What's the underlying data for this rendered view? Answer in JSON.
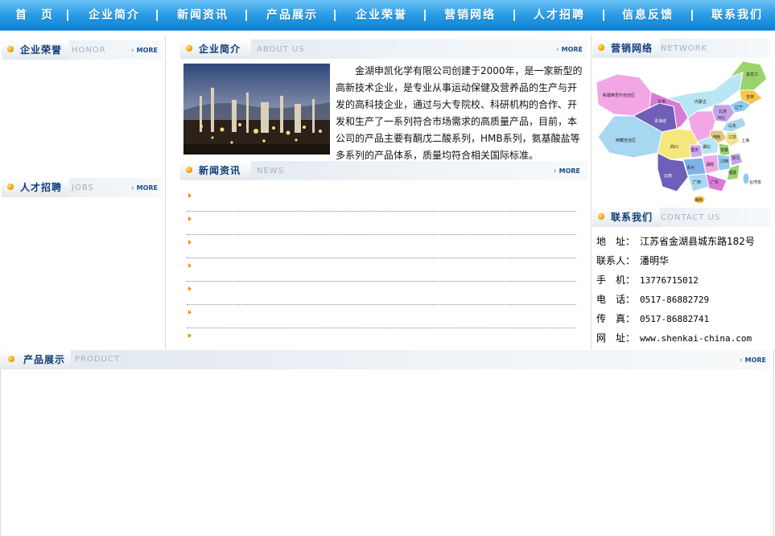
{
  "nav": {
    "items": [
      "首　页",
      "企业简介",
      "新闻资讯",
      "产品展示",
      "企业荣誉",
      "营销网络",
      "人才招聘",
      "信息反馈",
      "联系我们"
    ]
  },
  "honor": {
    "title_cn": "企业荣誉",
    "title_en": "HONOR",
    "more": "MORE"
  },
  "jobs": {
    "title_cn": "人才招聘",
    "title_en": "JOBS",
    "more": "MORE"
  },
  "about": {
    "title_cn": "企业简介",
    "title_en": "ABOUT US",
    "more": "MORE",
    "text": "金湖申凯化学有限公司创建于2000年，是一家新型的高新技术企业，是专业从事运动保健及营养品的生产与开发的高科技企业，通过与大专院校、科研机构的合作、开发和生产了一系列符合市场需求的高质量产品，目前，本公司的产品主要有酮戊二酸系列，HMB系列，氨基酸盐等多系列的产品体系，质量均符合相关国际标准。"
  },
  "news": {
    "title_cn": "新闻资讯",
    "title_en": "NEWS",
    "more": "MORE",
    "row_count": 7
  },
  "network": {
    "title_cn": "营销网络",
    "title_en": "NETWORK",
    "map_labels": [
      "新疆维吾尔自治区",
      "西藏自治区",
      "青海省",
      "甘肃",
      "四川",
      "内蒙古",
      "黑龙江",
      "吉林",
      "辽宁",
      "河北",
      "北京",
      "山东",
      "河南",
      "江苏",
      "上海",
      "安徽",
      "湖北",
      "重庆",
      "贵州",
      "湖南",
      "江西",
      "浙江",
      "福建",
      "云南",
      "广西",
      "广东",
      "海南",
      "台湾省"
    ]
  },
  "contact": {
    "title_cn": "联系我们",
    "title_en": "CONTACT US",
    "rows": [
      {
        "label": "地　址：",
        "value": "江苏省金湖县城东路182号"
      },
      {
        "label": "联系人：",
        "value": "潘明华"
      },
      {
        "label": "手　机：",
        "value": "13776715012"
      },
      {
        "label": "电　话：",
        "value": "0517-86882729"
      },
      {
        "label": "传　真：",
        "value": "0517-86882741"
      },
      {
        "label": "网　址：",
        "value": "www.shenkai-china.com"
      }
    ]
  },
  "product": {
    "title_cn": "产品展示",
    "title_en": "PRODUCT",
    "more": "MORE"
  },
  "colors": {
    "nav_top": "#6cc2f5",
    "nav_bottom": "#0b7fd4",
    "title_text": "#0d3c78",
    "bullet": "#f2a600",
    "news_arrow": "#f19000"
  }
}
